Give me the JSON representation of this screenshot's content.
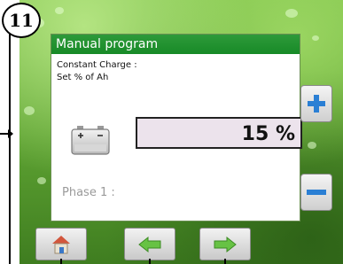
{
  "step_badge": "11",
  "panel": {
    "title": "Manual program",
    "description_line1": "Constant Charge :",
    "description_line2": "Set % of Ah",
    "value": "15 %",
    "phase_label": "Phase 1 :"
  },
  "icons": {
    "battery": "battery-icon",
    "plus": "plus-icon",
    "minus": "minus-icon",
    "home": "home-icon",
    "back": "arrow-left-icon",
    "ok": "ok-arrow-right-icon"
  },
  "colors": {
    "header_green": "#178a27",
    "background_green": "#5fa433",
    "value_box": "#ece3ec",
    "button_blue": "#2a7fd4",
    "arrow_green": "#67c244"
  }
}
